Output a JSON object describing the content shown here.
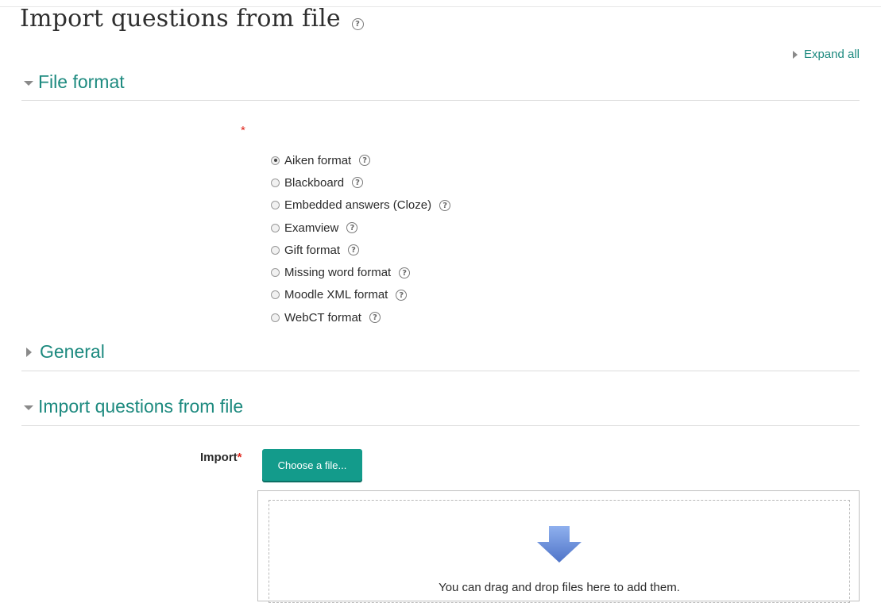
{
  "page": {
    "title": "Import questions from file",
    "expand_all_label": "Expand all"
  },
  "sections": {
    "file_format": {
      "title": "File format",
      "required_mark": "*"
    },
    "general": {
      "title": "General"
    },
    "import_section": {
      "title": "Import questions from file"
    }
  },
  "formats": [
    {
      "label": "Aiken format",
      "checked": true
    },
    {
      "label": "Blackboard",
      "checked": false
    },
    {
      "label": "Embedded answers (Cloze)",
      "checked": false
    },
    {
      "label": "Examview",
      "checked": false
    },
    {
      "label": "Gift format",
      "checked": false
    },
    {
      "label": "Missing word format",
      "checked": false
    },
    {
      "label": "Moodle XML format",
      "checked": false
    },
    {
      "label": "WebCT format",
      "checked": false
    }
  ],
  "import_field": {
    "label": "Import",
    "required_mark": "*",
    "choose_button": "Choose a file...",
    "drop_hint": "You can drag and drop files here to add them."
  },
  "icons": {
    "help": "question-circle-icon",
    "drop": "arrow-down-icon"
  },
  "colors": {
    "accent": "#1d8a7f",
    "button": "#139b8b",
    "required": "#e0261c",
    "arrow": "#6b8fd6"
  }
}
